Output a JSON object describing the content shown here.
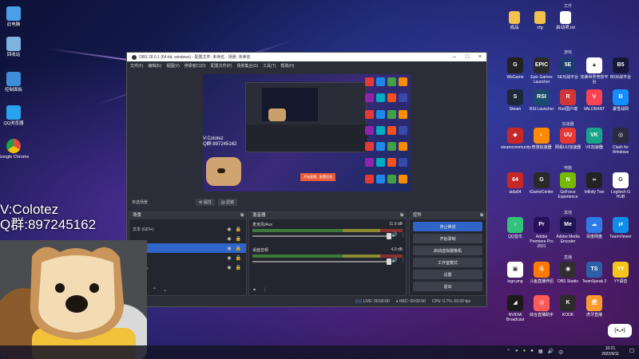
{
  "desktop": {
    "left_icons": [
      {
        "label": "此电脑",
        "icon": "pc-icon",
        "color": "#4a9fe8"
      },
      {
        "label": "回收站",
        "icon": "recycle-bin-icon",
        "color": "#7fb2e0"
      },
      {
        "label": "控制面板",
        "icon": "control-panel-icon",
        "color": "#3f8ed8"
      },
      {
        "label": "QQ浏览器",
        "icon": "qq-browser-icon",
        "color": "#2aa3ef"
      },
      {
        "label": "Google Chrome",
        "icon": "chrome-icon",
        "color": "#e24b3b"
      }
    ],
    "top_right_label": "文件",
    "top_right_files": [
      {
        "label": "成品",
        "icon": "folder-icon",
        "color": "#f2c14e"
      },
      {
        "label": "cfg",
        "icon": "file-icon",
        "color": "#f2c14e"
      },
      {
        "label": "启动项.txt",
        "icon": "txt-file-icon",
        "color": "#ffffff"
      }
    ],
    "sections": [
      {
        "label": "游戏",
        "items": [
          {
            "label": "WeGame",
            "color": "#222222",
            "glyph": "G"
          },
          {
            "label": "Epic Games Launcher",
            "color": "#2a2a2a",
            "glyph": "EPIC"
          },
          {
            "label": "5E对战平台",
            "color": "#1c3b6e",
            "glyph": "5E"
          },
          {
            "label": "完美世界竞技平台",
            "color": "#ffffff",
            "glyph": "▲"
          },
          {
            "label": "B5对战平台",
            "color": "#16183a",
            "glyph": "B5"
          }
        ]
      },
      {
        "label": "",
        "items": [
          {
            "label": "Steam",
            "color": "#1b2838",
            "glyph": "S"
          },
          {
            "label": "RSI Launcher",
            "color": "#1c4a6e",
            "glyph": "RSI"
          },
          {
            "label": "Riot国户端",
            "color": "#d13639",
            "glyph": "R"
          },
          {
            "label": "VALORANT",
            "color": "#fa4454",
            "glyph": "V"
          },
          {
            "label": "暴雪战网",
            "color": "#148eff",
            "glyph": "B"
          }
        ]
      },
      {
        "label": "加速器",
        "items": [
          {
            "label": "steamcommunity",
            "color": "#c62828",
            "glyph": "◆"
          },
          {
            "label": "奇游加速器",
            "color": "#ff8a00",
            "glyph": "◐"
          },
          {
            "label": "网易UU加速器",
            "color": "#e53935",
            "glyph": "UU"
          },
          {
            "label": "VK加速器",
            "color": "#17a589",
            "glyph": "VK"
          },
          {
            "label": "Clash for Windows",
            "color": "#2a2a40",
            "glyph": "◎"
          }
        ]
      },
      {
        "label": "电脑",
        "items": [
          {
            "label": "aida64",
            "color": "#c62828",
            "glyph": "64"
          },
          {
            "label": "iGameCenter",
            "color": "#2a2a2a",
            "glyph": "G"
          },
          {
            "label": "GeForce Experience",
            "color": "#76b900",
            "glyph": "N"
          },
          {
            "label": "Infinity Two",
            "color": "#222222",
            "glyph": "∞"
          },
          {
            "label": "Logitech G HUB",
            "color": "#ffffff",
            "glyph": "G"
          }
        ]
      },
      {
        "label": "其他",
        "items": [
          {
            "label": "QQ音乐",
            "color": "#31c27c",
            "glyph": "♪"
          },
          {
            "label": "Adobe Premiere Pro 2021",
            "color": "#2a0f5a",
            "glyph": "Pr"
          },
          {
            "label": "Adobe Media Encoder",
            "color": "#1e1450",
            "glyph": "Me"
          },
          {
            "label": "百度网盘",
            "color": "#2f7ce8",
            "glyph": "☁"
          },
          {
            "label": "TeamViewer",
            "color": "#0e8ee9",
            "glyph": "⇄"
          }
        ]
      },
      {
        "label": "直播",
        "items": [
          {
            "label": "logo.png",
            "color": "#ffffff",
            "glyph": "▣"
          },
          {
            "label": "斗鱼直播伴侣",
            "color": "#ff7b00",
            "glyph": "斗"
          },
          {
            "label": "OBS Studio",
            "color": "#302e31",
            "glyph": "◉"
          },
          {
            "label": "TeamSpeak 3",
            "color": "#2c5fa8",
            "glyph": "TS"
          },
          {
            "label": "YY语音",
            "color": "#f5c518",
            "glyph": "YY"
          }
        ]
      },
      {
        "label": "",
        "items": [
          {
            "label": "NVIDIA Broadcast",
            "color": "#1a1a1a",
            "glyph": "◢"
          },
          {
            "label": "综合直播助手",
            "color": "#ff5a5a",
            "glyph": "◎"
          },
          {
            "label": "KOOK",
            "color": "#2b2b2b",
            "glyph": "K"
          },
          {
            "label": "虎牙直播",
            "color": "#ff9a2e",
            "glyph": "虎"
          }
        ]
      }
    ]
  },
  "obs": {
    "title": "OBS 28.0.1 (64-bit, windows) - 配置文件: 未命名 - 场景: 未命名",
    "menu": [
      "文件(F)",
      "编辑(E)",
      "视图(V)",
      "停靠窗口(D)",
      "配置文件(P)",
      "场景集合(S)",
      "工具(T)",
      "帮助(H)"
    ],
    "scene_label": "未选场景",
    "scene_buttons": [
      "属性",
      "滤镜"
    ],
    "panels": {
      "scenes": "场景",
      "mixer": "混音器",
      "controls": "控件"
    },
    "sources": [
      {
        "label": "文本 (GDI+)",
        "selected": false
      },
      {
        "label": "",
        "selected": false
      },
      {
        "label": "",
        "selected": true
      },
      {
        "label": "",
        "selected": false
      },
      {
        "label": "音频输入",
        "selected": false
      }
    ],
    "mixer": [
      {
        "name": "麦克风/Aux",
        "db": "11.0 dB",
        "level": 0.65
      },
      {
        "name": "桌面音频",
        "db": "4.0 dB",
        "level": 0.5
      }
    ],
    "controls": [
      "停止推流",
      "开始录制",
      "启动虚拟摄像机",
      "工作室模式",
      "设置",
      "退出"
    ],
    "status": {
      "live": "LIVE: 00:00:00",
      "rec": "REC: 00:00:00",
      "cpu": "CPU: 0.7%, 60.00 fps"
    },
    "preview_button": "开始直播，配置信息"
  },
  "overlay": {
    "line1": "V:Colotez",
    "line2": "Q群:897245162",
    "mini_line1": "V:Colotez",
    "mini_line2": "Q群:897245162"
  },
  "taskbar": {
    "time": "10:21",
    "date": "2022/9/11"
  },
  "chat_bubble": "(•ᴗ•)"
}
